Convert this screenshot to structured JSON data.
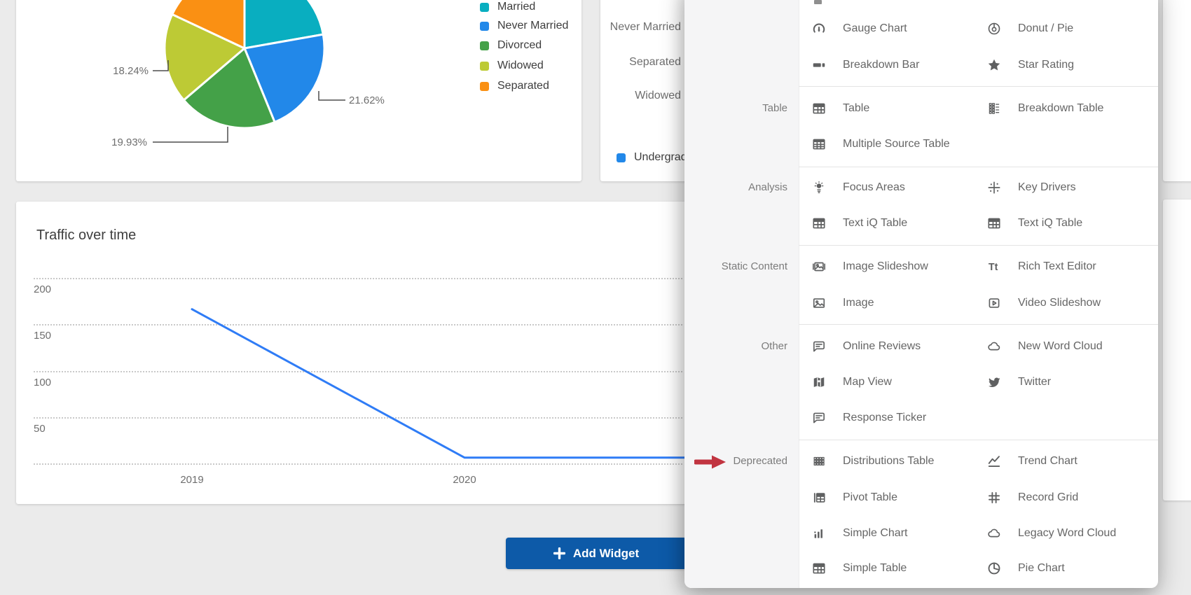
{
  "colors": {
    "page_bg": "#ebebeb",
    "accent_button_blue": "#0D5AA8",
    "annotation_red": "#C13440",
    "line_blue": "#2F7CF6",
    "legend_blue": "#2288E9"
  },
  "pie_card": {
    "legend": [
      {
        "label": "Married",
        "color": "#09AEC0"
      },
      {
        "label": "Never Married",
        "color": "#2288E9"
      },
      {
        "label": "Divorced",
        "color": "#44A148"
      },
      {
        "label": "Widowed",
        "color": "#BDCA35"
      },
      {
        "label": "Separated",
        "color": "#FA9013"
      }
    ],
    "callouts": [
      "18.24%",
      "19.93%",
      "21.62%"
    ]
  },
  "bar_card": {
    "category_labels": [
      "Never Married",
      "Separated",
      "Widowed"
    ],
    "legend": [
      {
        "label": "Undergrad",
        "color": "#2288E9"
      }
    ]
  },
  "traffic_card": {
    "title": "Traffic over time",
    "y_ticks": [
      "200",
      "150",
      "100",
      "50"
    ],
    "x_ticks": [
      "2019",
      "2020"
    ]
  },
  "add_widget": {
    "label": "Add Widget"
  },
  "annotation": {
    "label": "Deprecated",
    "arrow_color": "#C13440"
  },
  "panel": {
    "sections": [
      {
        "label": "",
        "items": [
          {
            "label": "Gauge Chart",
            "icon": "gauge-chart-icon",
            "col": 0,
            "row": 0
          },
          {
            "label": "Donut / Pie",
            "icon": "donut-pie-icon",
            "col": 1,
            "row": 0
          },
          {
            "label": "Breakdown Bar",
            "icon": "breakdown-bar-icon",
            "col": 0,
            "row": 1
          },
          {
            "label": "Star Rating",
            "icon": "star-rating-icon",
            "col": 1,
            "row": 1
          }
        ]
      },
      {
        "label": "Table",
        "items": [
          {
            "label": "Table",
            "icon": "table-icon",
            "col": 0,
            "row": 0
          },
          {
            "label": "Breakdown Table",
            "icon": "breakdown-table-icon",
            "col": 1,
            "row": 0
          },
          {
            "label": "Multiple Source Table",
            "icon": "multiple-source-table-icon",
            "col": 0,
            "row": 1
          }
        ]
      },
      {
        "label": "Analysis",
        "items": [
          {
            "label": "Focus Areas",
            "icon": "focus-areas-icon",
            "col": 0,
            "row": 0
          },
          {
            "label": "Key Drivers",
            "icon": "key-drivers-icon",
            "col": 1,
            "row": 0
          },
          {
            "label": "Text iQ Table",
            "icon": "table-icon",
            "col": 0,
            "row": 1
          },
          {
            "label": "Text iQ Table",
            "icon": "table-icon",
            "col": 1,
            "row": 1
          }
        ]
      },
      {
        "label": "Static Content",
        "items": [
          {
            "label": "Image Slideshow",
            "icon": "image-slideshow-icon",
            "col": 0,
            "row": 0
          },
          {
            "label": "Rich Text Editor",
            "icon": "rich-text-editor-icon",
            "col": 1,
            "row": 0
          },
          {
            "label": "Image",
            "icon": "image-icon",
            "col": 0,
            "row": 1
          },
          {
            "label": "Video Slideshow",
            "icon": "video-slideshow-icon",
            "col": 1,
            "row": 1
          }
        ]
      },
      {
        "label": "Other",
        "items": [
          {
            "label": "Online Reviews",
            "icon": "speech-bubble-icon",
            "col": 0,
            "row": 0
          },
          {
            "label": "New Word Cloud",
            "icon": "word-cloud-icon",
            "col": 1,
            "row": 0
          },
          {
            "label": "Map View",
            "icon": "map-view-icon",
            "col": 0,
            "row": 1
          },
          {
            "label": "Twitter",
            "icon": "twitter-icon",
            "col": 1,
            "row": 1
          },
          {
            "label": "Response Ticker",
            "icon": "speech-bubble-icon",
            "col": 0,
            "row": 2
          }
        ]
      },
      {
        "label": "Deprecated",
        "items": [
          {
            "label": "Distributions Table",
            "icon": "distributions-table-icon",
            "col": 0,
            "row": 0
          },
          {
            "label": "Trend Chart",
            "icon": "trend-chart-icon",
            "col": 1,
            "row": 0
          },
          {
            "label": "Pivot Table",
            "icon": "pivot-table-icon",
            "col": 0,
            "row": 1
          },
          {
            "label": "Record Grid",
            "icon": "record-grid-icon",
            "col": 1,
            "row": 1
          },
          {
            "label": "Simple Chart",
            "icon": "simple-chart-icon",
            "col": 0,
            "row": 2
          },
          {
            "label": "Legacy Word Cloud",
            "icon": "word-cloud-icon",
            "col": 1,
            "row": 2
          },
          {
            "label": "Simple Table",
            "icon": "table-icon",
            "col": 0,
            "row": 3
          },
          {
            "label": "Pie Chart",
            "icon": "pie-chart-icon",
            "col": 1,
            "row": 3
          }
        ]
      }
    ]
  },
  "chart_data": [
    {
      "type": "pie",
      "labels": [
        "Married",
        "Never Married",
        "Divorced",
        "Widowed",
        "Separated"
      ],
      "values": [
        22.21,
        21.62,
        19.93,
        18.24,
        18.0
      ],
      "colors": [
        "#09AEC0",
        "#2288E9",
        "#44A148",
        "#BDCA35",
        "#FA9013"
      ],
      "visible_slice_labels": [
        "21.62%",
        "19.93%",
        "18.24%"
      ],
      "legend_position": "right",
      "start_angle_deg": 0,
      "direction": "clockwise"
    },
    {
      "type": "line",
      "title": "Traffic over time",
      "x": [
        "2019",
        "2020"
      ],
      "values": [
        167,
        7
      ],
      "flat_extension_value": 7,
      "ylim": [
        0,
        200
      ],
      "yticks": [
        0,
        50,
        100,
        150,
        200
      ],
      "grid": "dotted horizontal",
      "line_color": "#2F7CF6"
    },
    {
      "type": "bar",
      "orientation": "horizontal",
      "categories": [
        "Never Married",
        "Separated",
        "Widowed"
      ],
      "legend": [
        "Undergrad"
      ],
      "note": "bar values hidden behind overlay panel"
    }
  ]
}
